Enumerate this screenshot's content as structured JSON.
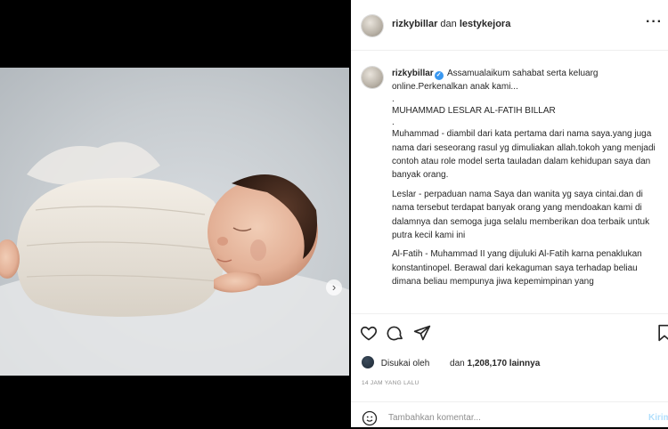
{
  "post": {
    "header": {
      "author": "rizkybillar",
      "joiner": "dan",
      "collaborator": "lestykejora",
      "more_label": "···"
    },
    "carousel": {
      "next_label": "›"
    },
    "caption": {
      "username": "rizkybillar",
      "verified_mark": "✓",
      "lines": [
        "Assamualaikum sahabat serta keluarg online.Perkenalkan anak kami...",
        ".",
        "MUHAMMAD LESLAR AL-FATIH BILLAR",
        ".",
        "Muhammad - diambil dari kata pertama dari nama saya.yang juga nama dari seseorang rasul yg dimuliakan allah.tokoh yang menjadi contoh atau role model serta tauladan dalam kehidupan saya dan banyak orang.",
        "Leslar - perpaduan nama Saya dan wanita yg saya cintai.dan di nama tersebut terdapat banyak orang yang mendoakan kami di dalamnya dan semoga juga selalu memberikan doa terbaik untuk putra kecil kami ini",
        "Al-Fatih - Muhammad II yang dijuluki Al-Fatih karna penaklukan konstantinopel. Berawal dari kekaguman saya terhadap beliau dimana beliau mempunya jiwa kepemimpinan yang"
      ]
    },
    "likes": {
      "prefix": "Disukai oleh",
      "joiner": "dan",
      "count": "1,208,170",
      "suffix": "lainnya"
    },
    "timestamp": "14 JAM YANG LALU",
    "comment": {
      "placeholder": "Tambahkan komentar...",
      "submit_label": "Kirim"
    }
  },
  "colors": {
    "accent": "#3897f0",
    "muted": "#8e8e8e",
    "submit_disabled": "#b2dffc"
  },
  "icons": [
    "heart-icon",
    "comment-icon",
    "share-icon",
    "bookmark-icon",
    "emoji-icon",
    "verified-badge-icon",
    "chevron-right-icon",
    "more-icon"
  ]
}
